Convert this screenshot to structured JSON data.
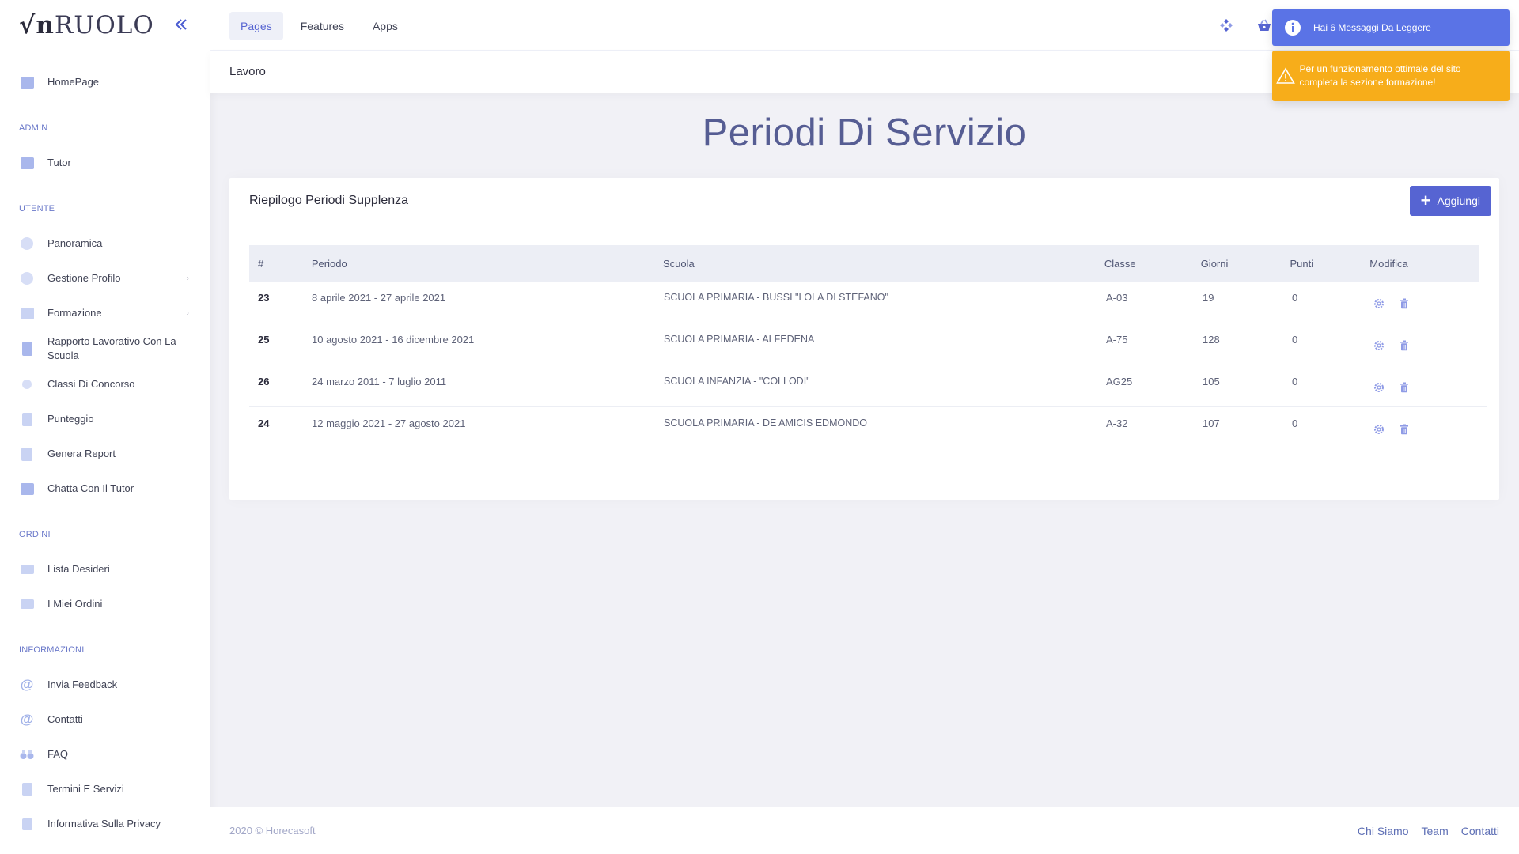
{
  "brand": {
    "logo_v": "√",
    "logo_n": "n",
    "logo_rest": "RUOLO"
  },
  "sidebar": {
    "homepage": "HomePage",
    "sections": {
      "admin": "ADMIN",
      "utente": "UTENTE",
      "ordini": "ORDINI",
      "informazioni": "INFORMAZIONI"
    },
    "admin_items": [
      "Tutor"
    ],
    "utente_items": [
      "Panoramica",
      "Gestione Profilo",
      "Formazione",
      "Rapporto Lavorativo Con La Scuola",
      "Classi Di Concorso",
      "Punteggio",
      "Genera Report",
      "Chatta Con Il Tutor"
    ],
    "ordini_items": [
      "Lista Desideri",
      "I Miei Ordini"
    ],
    "info_items": [
      "Invia Feedback",
      "Contatti",
      "FAQ",
      "Termini E Servizi",
      "Informativa Sulla Privacy"
    ]
  },
  "topnav": {
    "tabs": [
      "Pages",
      "Features",
      "Apps"
    ],
    "active": "Pages"
  },
  "subheader": {
    "breadcrumb": "Lavoro"
  },
  "toasts": {
    "info": "Hai 6 Messaggi Da Leggere",
    "warning": "Per un funzionamento ottimale del sito completa la sezione formazione!"
  },
  "page": {
    "title": "Periodi Di Servizio"
  },
  "card": {
    "title": "Riepilogo Periodi Supplenza",
    "add_label": "Aggiungi",
    "columns": [
      "#",
      "Periodo",
      "Scuola",
      "Classe",
      "Giorni",
      "Punti",
      "Modifica"
    ],
    "rows": [
      {
        "id": "23",
        "periodo": "8 aprile 2021 - 27 aprile 2021",
        "scuola": "SCUOLA PRIMARIA - BUSSI \"LOLA DI STEFANO\"",
        "classe": "A-03",
        "giorni": "19",
        "punti": "0"
      },
      {
        "id": "25",
        "periodo": "10 agosto 2021 - 16 dicembre 2021",
        "scuola": "SCUOLA PRIMARIA - ALFEDENA",
        "classe": "A-75",
        "giorni": "128",
        "punti": "0"
      },
      {
        "id": "26",
        "periodo": "24 marzo 2011 - 7 luglio 2011",
        "scuola": "SCUOLA INFANZIA - \"COLLODI\"",
        "classe": "AG25",
        "giorni": "105",
        "punti": "0"
      },
      {
        "id": "24",
        "periodo": "12 maggio 2021 - 27 agosto 2021",
        "scuola": "SCUOLA PRIMARIA - DE AMICIS EDMONDO",
        "classe": "A-32",
        "giorni": "107",
        "punti": "0"
      }
    ]
  },
  "footer": {
    "copyright": "2020 © Horecasoft",
    "links": [
      "Chi Siamo",
      "Team",
      "Contatti"
    ]
  },
  "colors": {
    "accent": "#5664d2",
    "info": "#5a73e6",
    "warning": "#f7ad1a"
  }
}
